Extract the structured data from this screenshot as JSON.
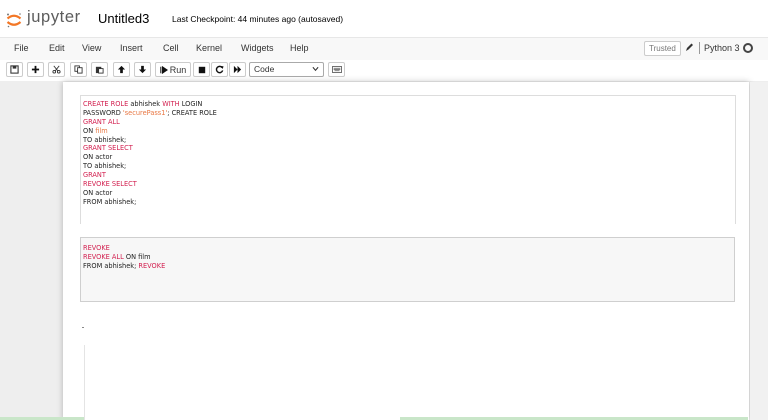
{
  "header": {
    "logo_text": "jupyter",
    "notebook_name": "Untitled3",
    "checkpoint_text": "Last Checkpoint: 44 minutes ago  (autosaved)"
  },
  "menu": {
    "items": [
      "File",
      "Edit",
      "View",
      "Insert",
      "Cell",
      "Kernel",
      "Widgets",
      "Help"
    ],
    "trusted_label": "Trusted",
    "kernel_name": "Python 3"
  },
  "toolbar": {
    "run_label": "Run",
    "cell_type": "Code",
    "icons": [
      "save-icon",
      "add-cell-icon",
      "cut-icon",
      "copy-icon",
      "paste-icon",
      "move-up-icon",
      "move-down-icon",
      "run-icon",
      "stop-icon",
      "restart-icon",
      "fast-forward-icon",
      "keyboard-icon"
    ]
  },
  "cells": [
    {
      "lines": [
        [
          {
            "t": "CREATE ROLE",
            "c": "kw"
          },
          {
            "t": " abhishek "
          },
          {
            "t": "WITH",
            "c": "kw"
          },
          {
            "t": " LOGIN"
          }
        ],
        [
          {
            "t": "PASSWORD "
          },
          {
            "t": "'securePass1'",
            "c": "str"
          },
          {
            "t": "; CREATE ROLE"
          }
        ],
        [
          {
            "t": "GRANT ALL",
            "c": "kw"
          }
        ],
        [
          {
            "t": "ON "
          },
          {
            "t": "film",
            "c": "str"
          }
        ],
        [
          {
            "t": "TO abhishek;"
          }
        ],
        [
          {
            "t": "GRANT SELECT",
            "c": "kw"
          }
        ],
        [
          {
            "t": "ON actor"
          }
        ],
        [
          {
            "t": "TO abhishek;"
          }
        ],
        [
          {
            "t": "GRANT",
            "c": "kw"
          }
        ],
        [
          {
            "t": "REVOKE SELECT",
            "c": "kw"
          }
        ],
        [
          {
            "t": "ON actor"
          }
        ],
        [
          {
            "t": "FROM abhishek;"
          }
        ]
      ]
    },
    {
      "lines": [
        [
          {
            "t": "REVOKE",
            "c": "kw"
          }
        ],
        [
          {
            "t": "REVOKE ALL",
            "c": "kw"
          },
          {
            "t": " ON film"
          }
        ],
        [
          {
            "t": "FROM abhishek; "
          },
          {
            "t": "REVOKE",
            "c": "kw"
          }
        ]
      ]
    }
  ],
  "colors": {
    "keyword": "#d21e4e",
    "string": "#e87844",
    "logo_orange": "#f37726"
  }
}
